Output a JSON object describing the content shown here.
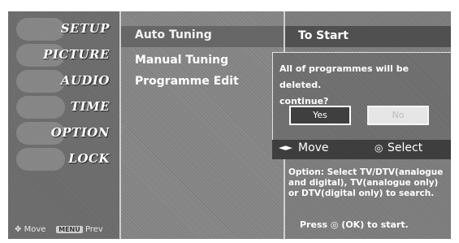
{
  "main_menu": {
    "items": [
      {
        "label": "SETUP"
      },
      {
        "label": "PICTURE"
      },
      {
        "label": "AUDIO"
      },
      {
        "label": "TIME"
      },
      {
        "label": "OPTION"
      },
      {
        "label": "LOCK"
      }
    ],
    "footer": {
      "move": "Move",
      "prev_key": "MENU",
      "prev": "Prev"
    }
  },
  "setup_menu": {
    "items": [
      {
        "label": "Auto Tuning"
      },
      {
        "label": "Manual Tuning"
      },
      {
        "label": "Programme Edit"
      }
    ]
  },
  "right_panel": {
    "header": "To Start",
    "help_text": "Option: Select TV/DTV(analogue and digital), TV(analogue only) or DTV(digital only) to search.",
    "start_hint": "Press ◎ (OK) to start."
  },
  "dialog": {
    "message_line1": "All of programmes will be deleted.",
    "message_line2": "continue?",
    "yes_label": "Yes",
    "no_label": "No"
  },
  "nav_hint": {
    "arrows": "◄►",
    "move": "Move",
    "ok_symbol": "◎",
    "select": "Select"
  }
}
